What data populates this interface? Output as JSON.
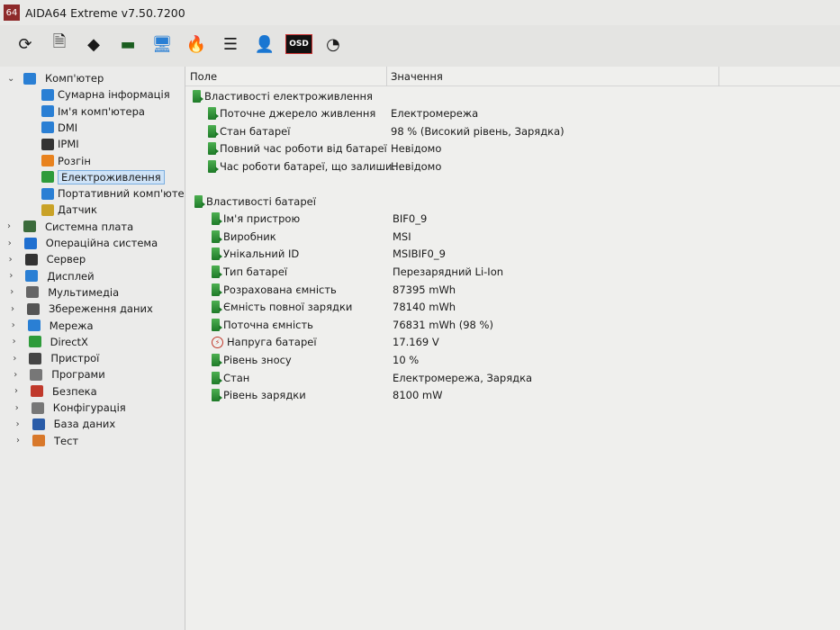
{
  "window": {
    "app_icon": "64",
    "title": "AIDA64 Extreme v7.50.7200"
  },
  "toolbar": [
    "refresh-icon",
    "report-icon",
    "motherboard-icon",
    "memory-icon",
    "network-icon",
    "overclock-icon",
    "tasks-icon",
    "user-icon",
    "osd-icon",
    "sensor-gauge-icon"
  ],
  "toolbar_osd": "OSD",
  "tree": [
    {
      "label": "Комп'ютер",
      "level": 0,
      "expanded": true,
      "color": "#2a7fd4"
    },
    {
      "label": "Сумарна інформація",
      "level": 1,
      "color": "#2a7fd4"
    },
    {
      "label": "Ім'я комп'ютера",
      "level": 1,
      "color": "#2a7fd4"
    },
    {
      "label": "DMI",
      "level": 1,
      "color": "#2a7fd4"
    },
    {
      "label": "IPMI",
      "level": 1,
      "color": "#333"
    },
    {
      "label": "Розгін",
      "level": 1,
      "color": "#e8821e"
    },
    {
      "label": "Електроживлення",
      "level": 1,
      "color": "#2e9b3a",
      "selected": true
    },
    {
      "label": "Портативний комп'ютер",
      "level": 1,
      "color": "#2a7fd4"
    },
    {
      "label": "Датчик",
      "level": 1,
      "color": "#c9a227"
    },
    {
      "label": "Системна плата",
      "level": 0,
      "color": "#3b6b3b"
    },
    {
      "label": "Операційна система",
      "level": 0,
      "color": "#1f6fd0"
    },
    {
      "label": "Сервер",
      "level": 0,
      "color": "#333"
    },
    {
      "label": "Дисплей",
      "level": 0,
      "color": "#2a7fd4"
    },
    {
      "label": "Мультимедіа",
      "level": 0,
      "color": "#666"
    },
    {
      "label": "Збереження даних",
      "level": 0,
      "color": "#555"
    },
    {
      "label": "Мережа",
      "level": 0,
      "color": "#2a7fd4"
    },
    {
      "label": "DirectX",
      "level": 0,
      "color": "#2e9b3a"
    },
    {
      "label": "Пристрої",
      "level": 0,
      "color": "#444"
    },
    {
      "label": "Програми",
      "level": 0,
      "color": "#777"
    },
    {
      "label": "Безпека",
      "level": 0,
      "color": "#c0392b"
    },
    {
      "label": "Конфігурація",
      "level": 0,
      "color": "#777"
    },
    {
      "label": "База даних",
      "level": 0,
      "color": "#2a5ca8"
    },
    {
      "label": "Тест",
      "level": 0,
      "color": "#d8782a"
    }
  ],
  "columns": {
    "field": "Поле",
    "value": "Значення"
  },
  "groups": [
    {
      "title": "Властивості електроживлення",
      "rows": [
        {
          "field": "Поточне джерело живлення",
          "value": "Електромережа"
        },
        {
          "field": "Стан батареї",
          "value": "98 % (Високий рівень, Зарядка)"
        },
        {
          "field": "Повний час роботи від батареї",
          "value": "Невідомо"
        },
        {
          "field": "Час роботи батареї, що залиши...",
          "value": "Невідомо"
        }
      ]
    },
    {
      "title": "Властивості батареї",
      "rows": [
        {
          "field": "Ім'я пристрою",
          "value": "BIF0_9"
        },
        {
          "field": "Виробник",
          "value": "MSI"
        },
        {
          "field": "Унікальний ID",
          "value": "MSIBIF0_9"
        },
        {
          "field": "Тип батареї",
          "value": "Перезарядний Li-Ion"
        },
        {
          "field": "Розрахована ємність",
          "value": "87395 mWh"
        },
        {
          "field": "Ємність повної зарядки",
          "value": "78140 mWh"
        },
        {
          "field": "Поточна ємність",
          "value": "76831 mWh  (98 %)"
        },
        {
          "field": "Напруга батареї",
          "value": "17.169 V",
          "icon": "voltage"
        },
        {
          "field": "Рівень зносу",
          "value": "10 %"
        },
        {
          "field": "Стан",
          "value": "Електромережа, Зарядка"
        },
        {
          "field": "Рівень зарядки",
          "value": "8100 mW"
        }
      ]
    }
  ]
}
